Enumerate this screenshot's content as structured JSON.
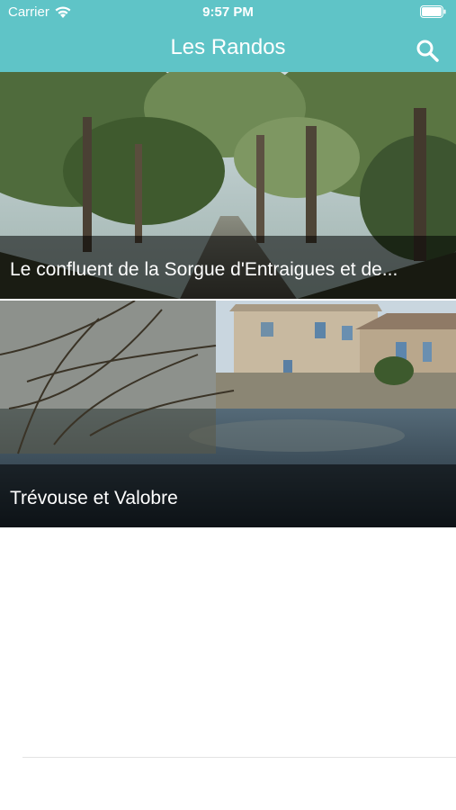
{
  "status_bar": {
    "carrier": "Carrier",
    "time": "9:57 PM",
    "icons": [
      "wifi-icon",
      "battery-icon"
    ]
  },
  "nav": {
    "title": "Les Randos",
    "search_icon": "search-icon"
  },
  "colors": {
    "header_background": "#5fc4c7",
    "caption_overlay": "rgba(0,0,0,0.55)",
    "page_background": "#ffffff"
  },
  "hikes": [
    {
      "title": "Le confluent de la Sorgue d'Entraigues et de..."
    },
    {
      "title": "Trévouse et Valobre"
    }
  ]
}
